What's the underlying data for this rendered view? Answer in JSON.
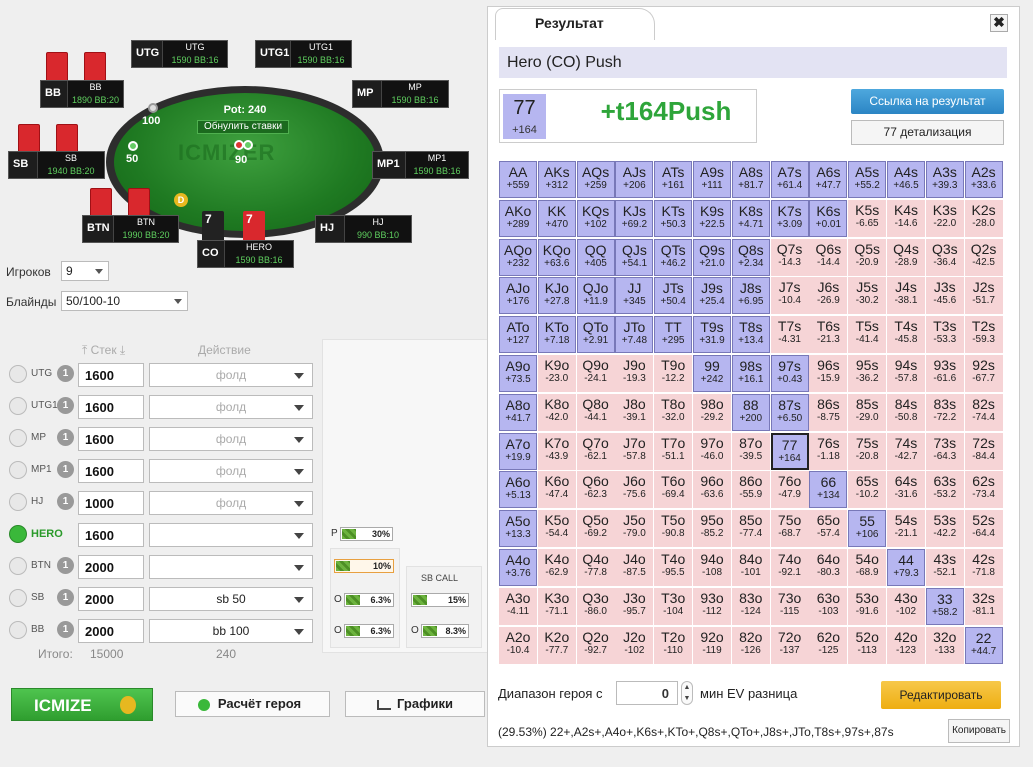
{
  "table": {
    "watermark": "ICMIZER",
    "pot_label": "Pot: 240",
    "reset_label": "Обнулить ставки",
    "chips": {
      "bb": "100",
      "sb": "50",
      "hero": "90"
    },
    "dealer": "D",
    "players": {
      "utg": {
        "pos": "UTG",
        "name": "UTG",
        "stack": "1590 BB:16"
      },
      "utg1": {
        "pos": "UTG1",
        "name": "UTG1",
        "stack": "1590 BB:16"
      },
      "mp": {
        "pos": "MP",
        "name": "MP",
        "stack": "1590 BB:16"
      },
      "mp1": {
        "pos": "MP1",
        "name": "MP1",
        "stack": "1590 BB:16"
      },
      "hj": {
        "pos": "HJ",
        "name": "HJ",
        "stack": "990 BB:10"
      },
      "co": {
        "pos": "CO",
        "name": "HERO",
        "stack": "1590 BB:16"
      },
      "btn": {
        "pos": "BTN",
        "name": "BTN",
        "stack": "1990 BB:20"
      },
      "sb": {
        "pos": "SB",
        "name": "SB",
        "stack": "1940 BB:20"
      },
      "bb": {
        "pos": "BB",
        "name": "BB",
        "stack": "1890 BB:20"
      }
    },
    "hero_cards": [
      "7",
      "7"
    ]
  },
  "controls": {
    "players_label": "Игроков",
    "players_value": "9",
    "blinds_label": "Блайнды",
    "blinds_value": "50/100-10",
    "stack_header": "Стек",
    "action_header": "Действие",
    "rows": [
      {
        "pos": "UTG",
        "badge": "1",
        "stack": "1600",
        "action": "фолд"
      },
      {
        "pos": "UTG1",
        "badge": "1",
        "stack": "1600",
        "action": "фолд"
      },
      {
        "pos": "MP",
        "badge": "1",
        "stack": "1600",
        "action": "фолд"
      },
      {
        "pos": "MP1",
        "badge": "1",
        "stack": "1600",
        "action": "фолд"
      },
      {
        "pos": "HJ",
        "badge": "1",
        "stack": "1000",
        "action": "фолд"
      },
      {
        "pos": "HERO",
        "badge": "",
        "stack": "1600",
        "action": ""
      },
      {
        "pos": "BTN",
        "badge": "1",
        "stack": "2000",
        "action": ""
      },
      {
        "pos": "SB",
        "badge": "1",
        "stack": "2000",
        "action": "sb 50"
      },
      {
        "pos": "BB",
        "badge": "1",
        "stack": "2000",
        "action": "bb 100"
      }
    ],
    "total_label": "Итого:",
    "total_stack": "15000",
    "total_action": "240"
  },
  "ranges": {
    "p_label": "P",
    "p_pct": "30%",
    "hero_pct": "10%",
    "o1_label": "O",
    "o1_pct": "6.3%",
    "o2_label": "O",
    "o2_pct": "6.3%",
    "sbcall_label": "SB CALL",
    "sbcall_pct": "15%",
    "sbcall_o_label": "O",
    "sbcall_o_pct": "8.3%"
  },
  "buttons": {
    "icmize": "ICMIZE",
    "hero_calc": "Расчёт героя",
    "graphs": "Графики"
  },
  "dialog": {
    "tab": "Результат",
    "close": "✖",
    "title": "Hero (CO) Push",
    "hand": "77",
    "hand_ev": "+164",
    "result_big": "+t164Push",
    "link_button": "Ссылка на результат",
    "detail_button": "77 детализация",
    "range_label": "Диапазон героя с",
    "range_value": "0",
    "range_label2": "мин EV разница",
    "edit_button": "Редактировать",
    "range_string": "(29.53%) 22+,A2s+,A4o+,K6s+,KTo+,Q8s+,QTo+,J8s+,JTo,T8s+,97s+,87s",
    "copy_button": "Копировать"
  },
  "grid": [
    [
      [
        "AA",
        "+559"
      ],
      [
        "AKs",
        "+312"
      ],
      [
        "AQs",
        "+259"
      ],
      [
        "AJs",
        "+206"
      ],
      [
        "ATs",
        "+161"
      ],
      [
        "A9s",
        "+111"
      ],
      [
        "A8s",
        "+81.7"
      ],
      [
        "A7s",
        "+61.4"
      ],
      [
        "A6s",
        "+47.7"
      ],
      [
        "A5s",
        "+55.2"
      ],
      [
        "A4s",
        "+46.5"
      ],
      [
        "A3s",
        "+39.3"
      ],
      [
        "A2s",
        "+33.6"
      ]
    ],
    [
      [
        "AKo",
        "+289"
      ],
      [
        "KK",
        "+470"
      ],
      [
        "KQs",
        "+102"
      ],
      [
        "KJs",
        "+69.2"
      ],
      [
        "KTs",
        "+50.3"
      ],
      [
        "K9s",
        "+22.5"
      ],
      [
        "K8s",
        "+4.71"
      ],
      [
        "K7s",
        "+3.09"
      ],
      [
        "K6s",
        "+0.01"
      ],
      [
        "K5s",
        "-6.65"
      ],
      [
        "K4s",
        "-14.6"
      ],
      [
        "K3s",
        "-22.0"
      ],
      [
        "K2s",
        "-28.0"
      ]
    ],
    [
      [
        "AQo",
        "+232"
      ],
      [
        "KQo",
        "+63.6"
      ],
      [
        "QQ",
        "+405"
      ],
      [
        "QJs",
        "+54.1"
      ],
      [
        "QTs",
        "+46.2"
      ],
      [
        "Q9s",
        "+21.0"
      ],
      [
        "Q8s",
        "+2.34"
      ],
      [
        "Q7s",
        "-14.3"
      ],
      [
        "Q6s",
        "-14.4"
      ],
      [
        "Q5s",
        "-20.9"
      ],
      [
        "Q4s",
        "-28.9"
      ],
      [
        "Q3s",
        "-36.4"
      ],
      [
        "Q2s",
        "-42.5"
      ]
    ],
    [
      [
        "AJo",
        "+176"
      ],
      [
        "KJo",
        "+27.8"
      ],
      [
        "QJo",
        "+11.9"
      ],
      [
        "JJ",
        "+345"
      ],
      [
        "JTs",
        "+50.4"
      ],
      [
        "J9s",
        "+25.4"
      ],
      [
        "J8s",
        "+6.95"
      ],
      [
        "J7s",
        "-10.4"
      ],
      [
        "J6s",
        "-26.9"
      ],
      [
        "J5s",
        "-30.2"
      ],
      [
        "J4s",
        "-38.1"
      ],
      [
        "J3s",
        "-45.6"
      ],
      [
        "J2s",
        "-51.7"
      ]
    ],
    [
      [
        "ATo",
        "+127"
      ],
      [
        "KTo",
        "+7.18"
      ],
      [
        "QTo",
        "+2.91"
      ],
      [
        "JTo",
        "+7.48"
      ],
      [
        "TT",
        "+295"
      ],
      [
        "T9s",
        "+31.9"
      ],
      [
        "T8s",
        "+13.4"
      ],
      [
        "T7s",
        "-4.31"
      ],
      [
        "T6s",
        "-21.3"
      ],
      [
        "T5s",
        "-41.4"
      ],
      [
        "T4s",
        "-45.8"
      ],
      [
        "T3s",
        "-53.3"
      ],
      [
        "T2s",
        "-59.3"
      ]
    ],
    [
      [
        "A9o",
        "+73.5"
      ],
      [
        "K9o",
        "-23.0"
      ],
      [
        "Q9o",
        "-24.1"
      ],
      [
        "J9o",
        "-19.3"
      ],
      [
        "T9o",
        "-12.2"
      ],
      [
        "99",
        "+242"
      ],
      [
        "98s",
        "+16.1"
      ],
      [
        "97s",
        "+0.43"
      ],
      [
        "96s",
        "-15.9"
      ],
      [
        "95s",
        "-36.2"
      ],
      [
        "94s",
        "-57.8"
      ],
      [
        "93s",
        "-61.6"
      ],
      [
        "92s",
        "-67.7"
      ]
    ],
    [
      [
        "A8o",
        "+41.7"
      ],
      [
        "K8o",
        "-42.0"
      ],
      [
        "Q8o",
        "-44.1"
      ],
      [
        "J8o",
        "-39.1"
      ],
      [
        "T8o",
        "-32.0"
      ],
      [
        "98o",
        "-29.2"
      ],
      [
        "88",
        "+200"
      ],
      [
        "87s",
        "+6.50"
      ],
      [
        "86s",
        "-8.75"
      ],
      [
        "85s",
        "-29.0"
      ],
      [
        "84s",
        "-50.8"
      ],
      [
        "83s",
        "-72.2"
      ],
      [
        "82s",
        "-74.4"
      ]
    ],
    [
      [
        "A7o",
        "+19.9"
      ],
      [
        "K7o",
        "-43.9"
      ],
      [
        "Q7o",
        "-62.1"
      ],
      [
        "J7o",
        "-57.8"
      ],
      [
        "T7o",
        "-51.1"
      ],
      [
        "97o",
        "-46.0"
      ],
      [
        "87o",
        "-39.5"
      ],
      [
        "77",
        "+164"
      ],
      [
        "76s",
        "-1.18"
      ],
      [
        "75s",
        "-20.8"
      ],
      [
        "74s",
        "-42.7"
      ],
      [
        "73s",
        "-64.3"
      ],
      [
        "72s",
        "-84.4"
      ]
    ],
    [
      [
        "A6o",
        "+5.13"
      ],
      [
        "K6o",
        "-47.4"
      ],
      [
        "Q6o",
        "-62.3"
      ],
      [
        "J6o",
        "-75.6"
      ],
      [
        "T6o",
        "-69.4"
      ],
      [
        "96o",
        "-63.6"
      ],
      [
        "86o",
        "-55.9"
      ],
      [
        "76o",
        "-47.9"
      ],
      [
        "66",
        "+134"
      ],
      [
        "65s",
        "-10.2"
      ],
      [
        "64s",
        "-31.6"
      ],
      [
        "63s",
        "-53.2"
      ],
      [
        "62s",
        "-73.4"
      ]
    ],
    [
      [
        "A5o",
        "+13.3"
      ],
      [
        "K5o",
        "-54.4"
      ],
      [
        "Q5o",
        "-69.2"
      ],
      [
        "J5o",
        "-79.0"
      ],
      [
        "T5o",
        "-90.8"
      ],
      [
        "95o",
        "-85.2"
      ],
      [
        "85o",
        "-77.4"
      ],
      [
        "75o",
        "-68.7"
      ],
      [
        "65o",
        "-57.4"
      ],
      [
        "55",
        "+106"
      ],
      [
        "54s",
        "-21.1"
      ],
      [
        "53s",
        "-42.2"
      ],
      [
        "52s",
        "-64.4"
      ]
    ],
    [
      [
        "A4o",
        "+3.76"
      ],
      [
        "K4o",
        "-62.9"
      ],
      [
        "Q4o",
        "-77.8"
      ],
      [
        "J4o",
        "-87.5"
      ],
      [
        "T4o",
        "-95.5"
      ],
      [
        "94o",
        "-108"
      ],
      [
        "84o",
        "-101"
      ],
      [
        "74o",
        "-92.1"
      ],
      [
        "64o",
        "-80.3"
      ],
      [
        "54o",
        "-68.9"
      ],
      [
        "44",
        "+79.3"
      ],
      [
        "43s",
        "-52.1"
      ],
      [
        "42s",
        "-71.8"
      ]
    ],
    [
      [
        "A3o",
        "-4.11"
      ],
      [
        "K3o",
        "-71.1"
      ],
      [
        "Q3o",
        "-86.0"
      ],
      [
        "J3o",
        "-95.7"
      ],
      [
        "T3o",
        "-104"
      ],
      [
        "93o",
        "-112"
      ],
      [
        "83o",
        "-124"
      ],
      [
        "73o",
        "-115"
      ],
      [
        "63o",
        "-103"
      ],
      [
        "53o",
        "-91.6"
      ],
      [
        "43o",
        "-102"
      ],
      [
        "33",
        "+58.2"
      ],
      [
        "32s",
        "-81.1"
      ]
    ],
    [
      [
        "A2o",
        "-10.4"
      ],
      [
        "K2o",
        "-77.7"
      ],
      [
        "Q2o",
        "-92.7"
      ],
      [
        "J2o",
        "-102"
      ],
      [
        "T2o",
        "-110"
      ],
      [
        "92o",
        "-119"
      ],
      [
        "82o",
        "-126"
      ],
      [
        "72o",
        "-137"
      ],
      [
        "62o",
        "-125"
      ],
      [
        "52o",
        "-113"
      ],
      [
        "42o",
        "-123"
      ],
      [
        "32o",
        "-133"
      ],
      [
        "22",
        "+44.7"
      ]
    ]
  ]
}
